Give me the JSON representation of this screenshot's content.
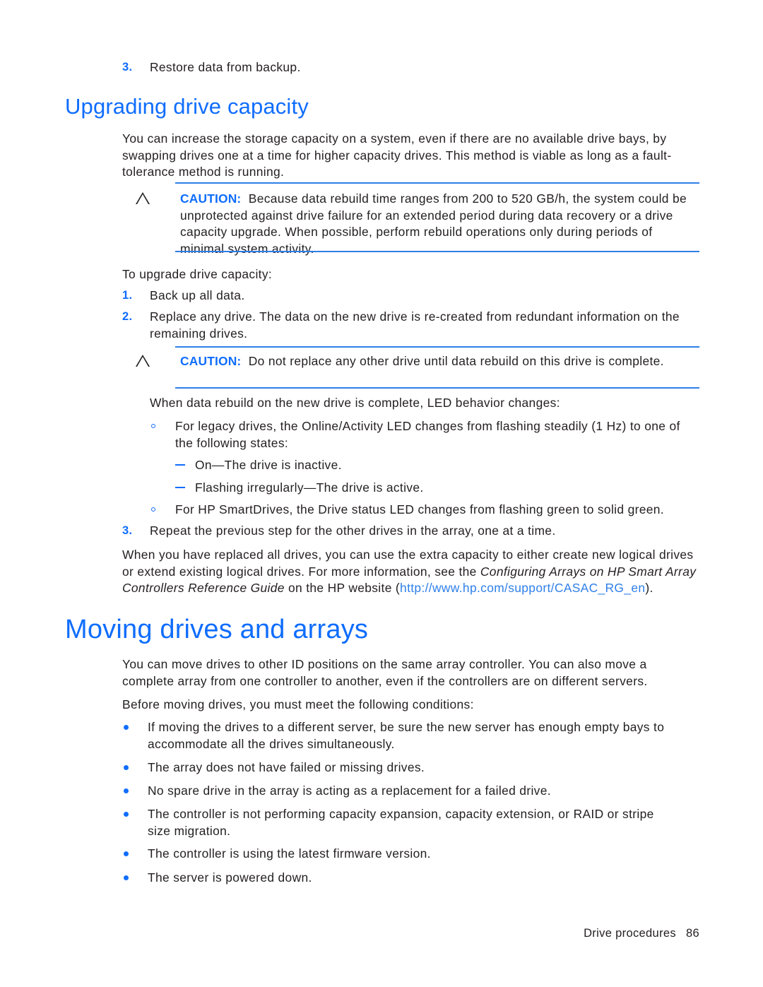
{
  "document": {
    "intro_step": {
      "number": "3.",
      "text": "Restore data from backup."
    },
    "section_upgrading": {
      "heading": "Upgrading drive capacity",
      "intro_paragraph": "You can increase the storage capacity on a system, even if there are no available drive bays, by swapping drives one at a time for higher capacity drives. This method is viable as long as a fault-tolerance method is running.",
      "caution_1": {
        "icon": "caution-triangle-icon",
        "label": "CAUTION:",
        "text": "Because data rebuild time ranges from 200 to 520 GB/h, the system could be unprotected against drive failure for an extended period during data recovery or a drive capacity upgrade. When possible, perform rebuild operations only during periods of minimal system activity."
      },
      "lead_in": "To upgrade drive capacity:",
      "steps": [
        {
          "number": "1.",
          "text": "Back up all data."
        },
        {
          "number": "2.",
          "text": "Replace any drive. The data on the new drive is re-created from redundant information on the remaining drives."
        }
      ],
      "caution_2": {
        "icon": "caution-triangle-icon",
        "label": "CAUTION:",
        "text": "Do not replace any other drive until data rebuild on this drive is complete."
      },
      "led_intro": "When data rebuild on the new drive is complete, LED behavior changes:",
      "led_bullets": [
        "For legacy drives, the Online/Activity LED changes from flashing steadily (1 Hz) to one of the following states:",
        "For HP SmartDrives, the Drive status LED changes from flashing green to solid green."
      ],
      "led_sub_bullets": [
        "On—The drive is inactive.",
        "Flashing irregularly—The drive is active."
      ],
      "step_3": {
        "number": "3.",
        "text": "Repeat the previous step for the other drives in the array, one at a time."
      },
      "closing_paragraph": {
        "part1": "When you have replaced all drives, you can use the extra capacity to either create new logical drives or extend existing logical drives. For more information, see the ",
        "italic1": "Configuring Arrays on HP Smart Array Controllers Reference Guide",
        "part2": " on the HP website (",
        "link": "http://www.hp.com/support/CASAC_RG_en",
        "part3": ")."
      }
    },
    "section_moving": {
      "heading": "Moving drives and arrays",
      "paragraph_1": "You can move drives to other ID positions on the same array controller. You can also move a complete array from one controller to another, even if the controllers are on different servers.",
      "paragraph_2": "Before moving drives, you must meet the following conditions:",
      "conditions": [
        "If moving the drives to a different server, be sure the new server has enough empty bays to accommodate all the drives simultaneously.",
        "The array does not have failed or missing drives.",
        "No spare drive in the array is acting as a replacement for a failed drive.",
        "The controller is not performing capacity expansion, capacity extension, or RAID or stripe size migration.",
        "The controller is using the latest firmware version.",
        "The server is powered down."
      ]
    },
    "footer": {
      "label": "Drive procedures",
      "page_number": "86"
    },
    "colors": {
      "heading_blue": "#0f6dfd",
      "rule_blue": "#2f7fe8",
      "body_black": "#231f20",
      "link_blue": "#2f7fe8"
    }
  }
}
